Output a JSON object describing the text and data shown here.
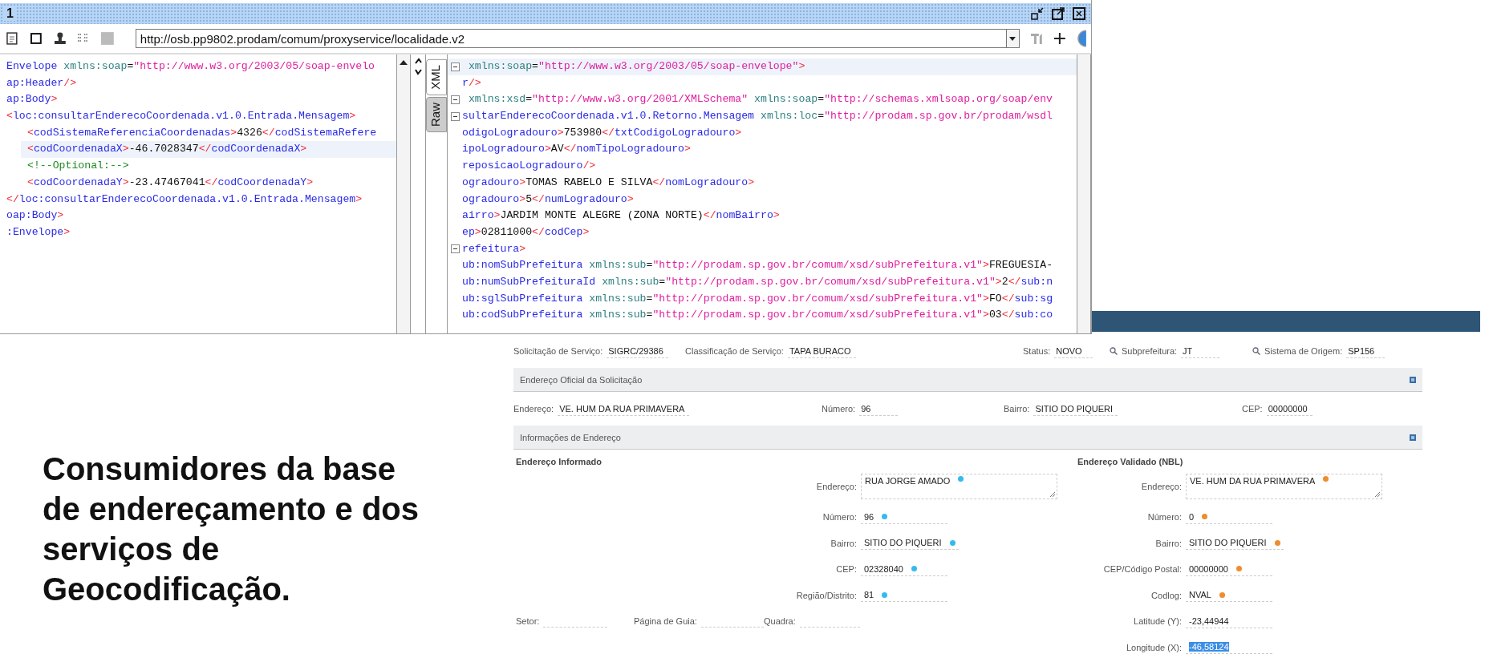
{
  "slide_text": "Consumidores da base de endereçamento e dos serviços de Geocodificação.",
  "client_window": {
    "title": "1",
    "url": "http://osb.pp9802.prodam/comum/proxyservice/localidade.v2",
    "tabs": [
      {
        "label": "XML",
        "selected": true
      },
      {
        "label": "Raw",
        "selected": false
      }
    ],
    "request_lines": [
      {
        "text": "Envelope xmlns:soap=\"http://www.w3.org/2003/05/soap-envelo",
        "kind": "tag",
        "highlighted": false
      },
      {
        "text": "ap:Header/>",
        "kind": "tag",
        "highlighted": false
      },
      {
        "text": "ap:Body>",
        "kind": "tag",
        "highlighted": false
      },
      {
        "text": "<loc:consultarEnderecoCoordenada.v1.0.Entrada.Mensagem>",
        "kind": "content",
        "highlighted": false,
        "children": [
          {
            "text": "<codSistemaReferenciaCoordenadas>4326</codSistemaRefere",
            "kind": "content",
            "highlighted": false
          },
          {
            "text": "<codCoordenadaX>-46.7028347</codCoordenadaX>",
            "kind": "content",
            "highlighted": true
          },
          {
            "text": "<!--Optional:-->",
            "kind": "content",
            "highlighted": false
          },
          {
            "text": "<codCoordenadaY>-23.47467041</codCoordenadaY>",
            "kind": "content",
            "highlighted": false
          }
        ]
      },
      {
        "text": "</loc:consultarEnderecoCoordenada.v1.0.Entrada.Mensagem>",
        "kind": "content",
        "highlighted": false
      },
      {
        "text": "oap:Body>",
        "kind": "tag",
        "highlighted": false
      },
      {
        "text": ":Envelope>",
        "kind": "tag",
        "highlighted": false
      }
    ],
    "response_lines": [
      {
        "text": " xmlns:soap=\"http://www.w3.org/2003/05/soap-envelope\">",
        "kind": "attribute",
        "collapsible": true,
        "highlighted": true
      },
      {
        "text": "r/>",
        "kind": "tag",
        "collapsible": false,
        "highlighted": false
      },
      {
        "text": " xmlns:xsd=\"http://www.w3.org/2001/XMLSchema\" xmlns:soap=\"http://schemas.xmlsoap.org/soap/env",
        "kind": "attribute",
        "collapsible": true,
        "highlighted": false
      },
      {
        "text": "sultarEnderecoCoordenada.v1.0.Retorno.Mensagem xmlns:loc=\"http://prodam.sp.gov.br/prodam/wsdl",
        "kind": "tag",
        "collapsible": true,
        "highlighted": false
      },
      {
        "text": "odigoLogradouro>753980</txtCodigoLogradouro>",
        "kind": "tag",
        "collapsible": false,
        "highlighted": false
      },
      {
        "text": "ipoLogradouro>AV</nomTipoLogradouro>",
        "kind": "tag",
        "collapsible": false,
        "highlighted": false
      },
      {
        "text": "reposicaoLogradouro/>",
        "kind": "tag",
        "collapsible": false,
        "highlighted": false
      },
      {
        "text": "ogradouro>TOMAS RABELO E SILVA</nomLogradouro>",
        "kind": "tag",
        "collapsible": false,
        "highlighted": false
      },
      {
        "text": "ogradouro>5</numLogradouro>",
        "kind": "tag",
        "collapsible": false,
        "highlighted": false
      },
      {
        "text": "airro>JARDIM MONTE ALEGRE (ZONA NORTE)</nomBairro>",
        "kind": "tag",
        "collapsible": false,
        "highlighted": false
      },
      {
        "text": "ep>02811000</codCep>",
        "kind": "tag",
        "collapsible": false,
        "highlighted": false
      },
      {
        "text": "refeitura>",
        "kind": "tag",
        "collapsible": true,
        "highlighted": false
      },
      {
        "text": "ub:nomSubPrefeitura xmlns:sub=\"http://prodam.sp.gov.br/comum/xsd/subPrefeitura.v1\">FREGUESIA-",
        "kind": "tag",
        "collapsible": false,
        "highlighted": false
      },
      {
        "text": "ub:numSubPrefeituraId xmlns:sub=\"http://prodam.sp.gov.br/comum/xsd/subPrefeitura.v1\">2</sub:n",
        "kind": "tag",
        "collapsible": false,
        "highlighted": false
      },
      {
        "text": "ub:sglSubPrefeitura xmlns:sub=\"http://prodam.sp.gov.br/comum/xsd/subPrefeitura.v1\">FO</sub:sg",
        "kind": "tag",
        "collapsible": false,
        "highlighted": false
      },
      {
        "text": "ub:codSubPrefeitura xmlns:sub=\"http://prodam.sp.gov.br/comum/xsd/subPrefeitura.v1\">03</sub:co",
        "kind": "tag",
        "collapsible": false,
        "highlighted": false
      }
    ]
  },
  "service_form": {
    "summary": [
      {
        "label": "Solicitação de Serviço:",
        "value": "SIGRC/29386",
        "searchable": false
      },
      {
        "label": "Classificação de Serviço:",
        "value": "TAPA BURACO",
        "searchable": false
      },
      {
        "label": "Status:",
        "value": "NOVO",
        "searchable": false
      },
      {
        "label": "Subprefeitura:",
        "value": "JT",
        "searchable": true
      },
      {
        "label": "Sistema de Origem:",
        "value": "SP156",
        "searchable": true
      }
    ],
    "official_address": {
      "title": "Endereço Oficial da Solicitação",
      "fields": [
        {
          "label": "Endereço:",
          "value": "VE. HUM DA RUA PRIMAVERA"
        },
        {
          "label": "Número:",
          "value": "96"
        },
        {
          "label": "Bairro:",
          "value": "SITIO DO PIQUERI"
        },
        {
          "label": "CEP:",
          "value": "00000000"
        }
      ]
    },
    "address_info": {
      "title": "Informações de Endereço",
      "given": {
        "title": "Endereço Informado",
        "fields": [
          {
            "label": "Endereço:",
            "value": "RUA JORGE AMADO",
            "kind": "textarea",
            "color": "#33bbee"
          },
          {
            "label": "Número:",
            "value": "96",
            "kind": "text",
            "color": "#33bbee"
          },
          {
            "label": "Bairro:",
            "value": "SITIO DO PIQUERI",
            "kind": "text",
            "color": "#33bbee"
          },
          {
            "label": "CEP:",
            "value": "02328040",
            "kind": "text",
            "color": "#33bbee"
          },
          {
            "label": "Região/Distrito:",
            "value": "81",
            "kind": "text",
            "color": "#33bbee"
          }
        ]
      },
      "location_fields": [
        {
          "label": "Setor:"
        },
        {
          "label": "Página de Guia:"
        },
        {
          "label": "Quadra:"
        }
      ],
      "validated": {
        "title": "Endereço Validado (NBL)",
        "fields": [
          {
            "label": "Endereço:",
            "value": "VE. HUM DA RUA PRIMAVERA",
            "kind": "textarea",
            "color": "#f08c2c",
            "selected": false
          },
          {
            "label": "Número:",
            "value": "0",
            "kind": "text",
            "color": "#f08c2c",
            "selected": false
          },
          {
            "label": "Bairro:",
            "value": "SITIO DO PIQUERI",
            "kind": "text",
            "color": "#f08c2c",
            "selected": false
          },
          {
            "label": "CEP/Código Postal:",
            "value": "00000000",
            "kind": "text",
            "color": "#f08c2c",
            "selected": false
          },
          {
            "label": "Codlog:",
            "value": "NVAL",
            "kind": "text",
            "color": "#f08c2c",
            "selected": false
          },
          {
            "label": "Latitude (Y):",
            "value": "-23,44944",
            "kind": "text",
            "selected": false
          },
          {
            "label": "Longitude (X):",
            "value": "-46,58124",
            "kind": "text",
            "selected": true
          }
        ]
      }
    }
  }
}
